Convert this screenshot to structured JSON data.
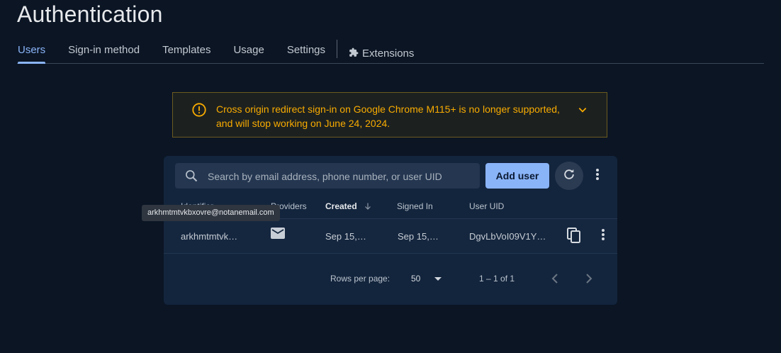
{
  "page": {
    "title": "Authentication"
  },
  "tabs": [
    {
      "label": "Users",
      "active": true
    },
    {
      "label": "Sign-in method"
    },
    {
      "label": "Templates"
    },
    {
      "label": "Usage"
    },
    {
      "label": "Settings"
    },
    {
      "label": "Extensions",
      "icon": "puzzle-icon"
    }
  ],
  "banner": {
    "icon": "warning-icon",
    "text_line1": "Cross origin redirect sign-in on Google Chrome M115+ is no longer supported,",
    "text_line2": "and will stop working on June 24, 2024.",
    "color": "#f9ab00"
  },
  "toolbar": {
    "search_placeholder": "Search by email address, phone number, or user UID",
    "add_user_label": "Add user"
  },
  "table": {
    "columns": [
      "Identifier",
      "Providers",
      "Created",
      "Signed In",
      "User UID"
    ],
    "sort_column": "Created",
    "rows": [
      {
        "identifier": "arkhmtmtvk…",
        "provider": "mail-icon",
        "created": "Sep 15,…",
        "signed_in": "Sep 15,…",
        "uid": "DgvLbVoI09V1Y…"
      }
    ]
  },
  "tooltip": {
    "text": "arkhmtmtvkbxovre@notanemail.com"
  },
  "pagination": {
    "rows_per_page_label": "Rows per page:",
    "rows_per_page": "50",
    "range": "1 – 1 of 1"
  },
  "colors": {
    "accent": "#8ab4f8",
    "background": "#0b1524",
    "card": "#13253d",
    "warning": "#f9ab00"
  }
}
